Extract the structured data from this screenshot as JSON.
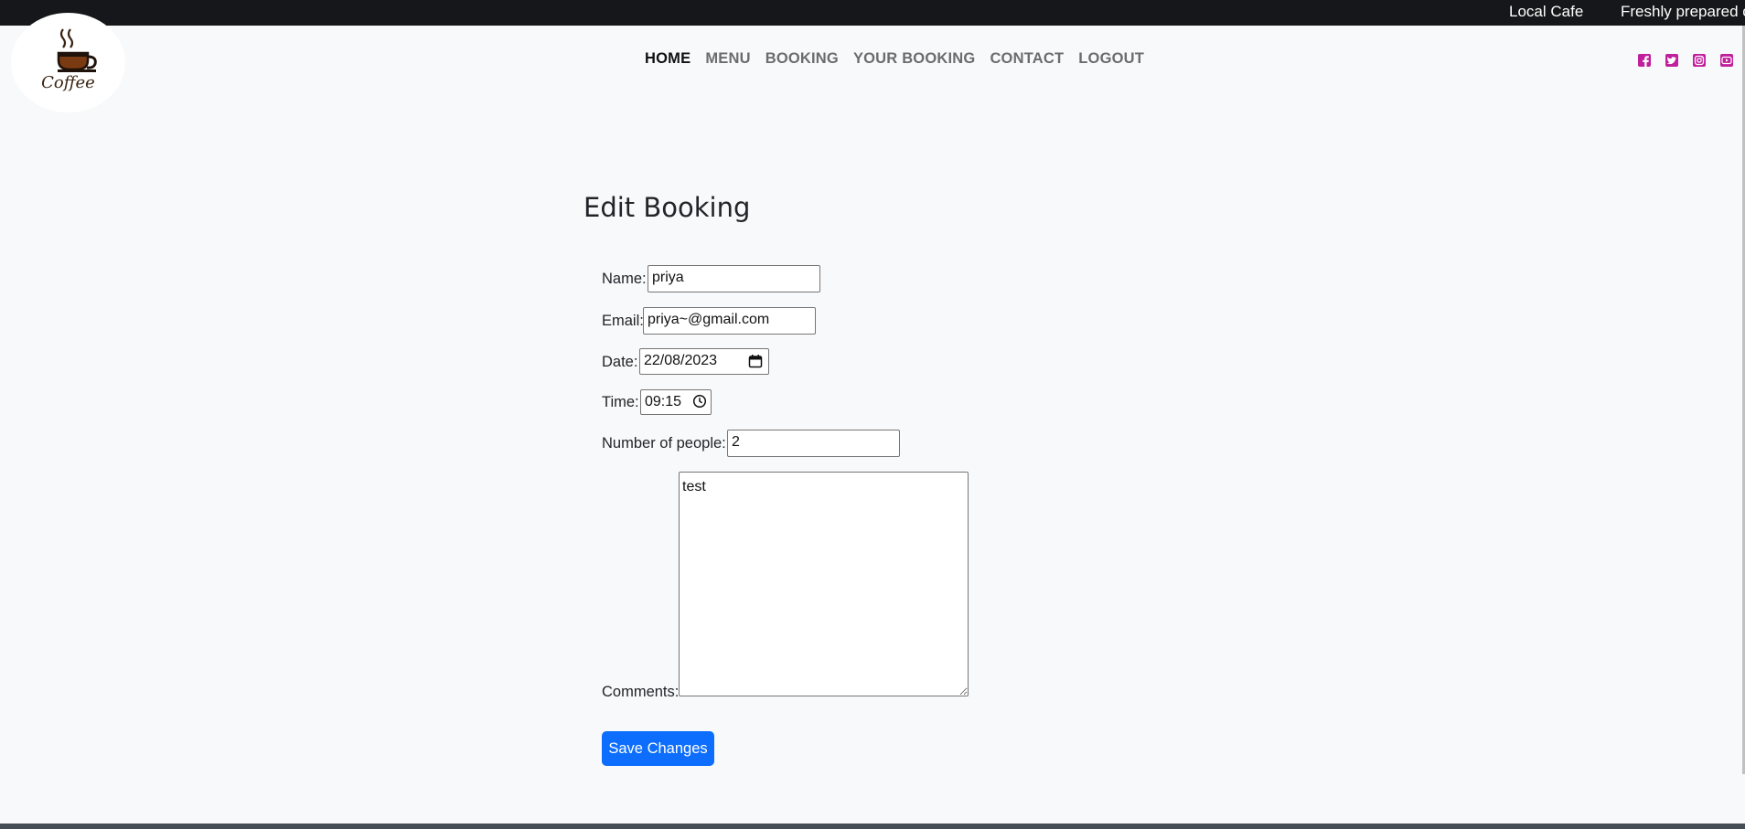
{
  "topbar": {
    "ticker_items": [
      "Local Cafe",
      "Freshly prepared cof"
    ]
  },
  "logo": {
    "text": "Coffee"
  },
  "nav": {
    "items": [
      {
        "label": "HOME",
        "active": true
      },
      {
        "label": "MENU"
      },
      {
        "label": "BOOKING"
      },
      {
        "label": "YOUR BOOKING"
      },
      {
        "label": "CONTACT"
      },
      {
        "label": "LOGOUT"
      }
    ]
  },
  "social": {
    "icons": [
      "facebook-icon",
      "twitter-icon",
      "instagram-icon",
      "youtube-icon"
    ],
    "color": "#c0209b"
  },
  "form": {
    "title": "Edit Booking",
    "name_label": "Name:",
    "name_value": "priya",
    "email_label": "Email:",
    "email_value": "priya~@gmail.com",
    "date_label": "Date:",
    "date_value": "22/08/2023",
    "time_label": "Time:",
    "time_value": "09:15",
    "people_label": "Number of people:",
    "people_value": "2",
    "comments_label": "Comments:",
    "comments_value": "test",
    "submit_label": "Save Changes"
  },
  "colors": {
    "primary": "#0d6efd",
    "topbar": "#16171a",
    "background": "#f8f9fa"
  }
}
